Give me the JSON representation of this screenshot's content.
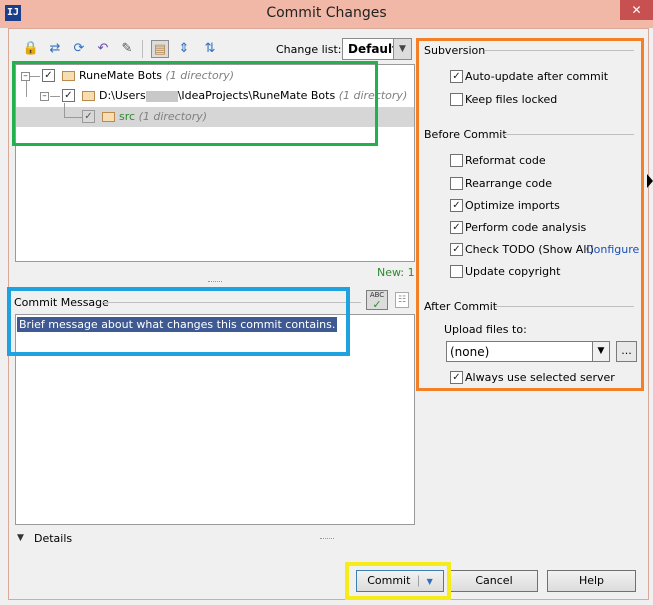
{
  "window": {
    "title": "Commit Changes",
    "close_label": "✕",
    "app_icon_label": "IJ"
  },
  "toolbar": {
    "changelist_label": "Change list:",
    "changelist_value": "Default"
  },
  "tree": {
    "root": {
      "label": "RuneMate Bots",
      "meta": "(1 directory)"
    },
    "path": {
      "prefix": "D:\\Users",
      "suffix": "\\IdeaProjects\\RuneMate Bots",
      "meta": "(1 directory)"
    },
    "leaf": {
      "label": "src",
      "meta": "(1 directory)"
    }
  },
  "new_count": "New: 1",
  "commit_message": {
    "label": "Commit Message",
    "text": "Brief message about what changes this commit contains.",
    "spellcheck_label": "ABC"
  },
  "details_label": "Details",
  "subversion": {
    "title": "Subversion",
    "options": [
      {
        "label": "Auto-update after commit",
        "checked": true
      },
      {
        "label": "Keep files locked",
        "checked": false
      }
    ]
  },
  "before_commit": {
    "title": "Before Commit",
    "options": [
      {
        "label": "Reformat code",
        "checked": false
      },
      {
        "label": "Rearrange code",
        "checked": false
      },
      {
        "label": "Optimize imports",
        "checked": true
      },
      {
        "label": "Perform code analysis",
        "checked": true
      },
      {
        "label": "Check TODO (Show All)",
        "checked": true
      },
      {
        "label": "Update copyright",
        "checked": false
      }
    ],
    "configure_link": "Configure"
  },
  "after_commit": {
    "title": "After Commit",
    "upload_label": "Upload files to:",
    "upload_value": "(none)",
    "browse_label": "...",
    "always_use_label": "Always use selected server",
    "always_use_checked": true
  },
  "buttons": {
    "commit": "Commit",
    "cancel": "Cancel",
    "help": "Help"
  },
  "colors": {
    "annotation_green": "#22b14c",
    "annotation_blue": "#1ea2e0",
    "annotation_orange": "#f57f27",
    "annotation_yellow": "#f5ec1a",
    "selection": "#3f5a92"
  }
}
